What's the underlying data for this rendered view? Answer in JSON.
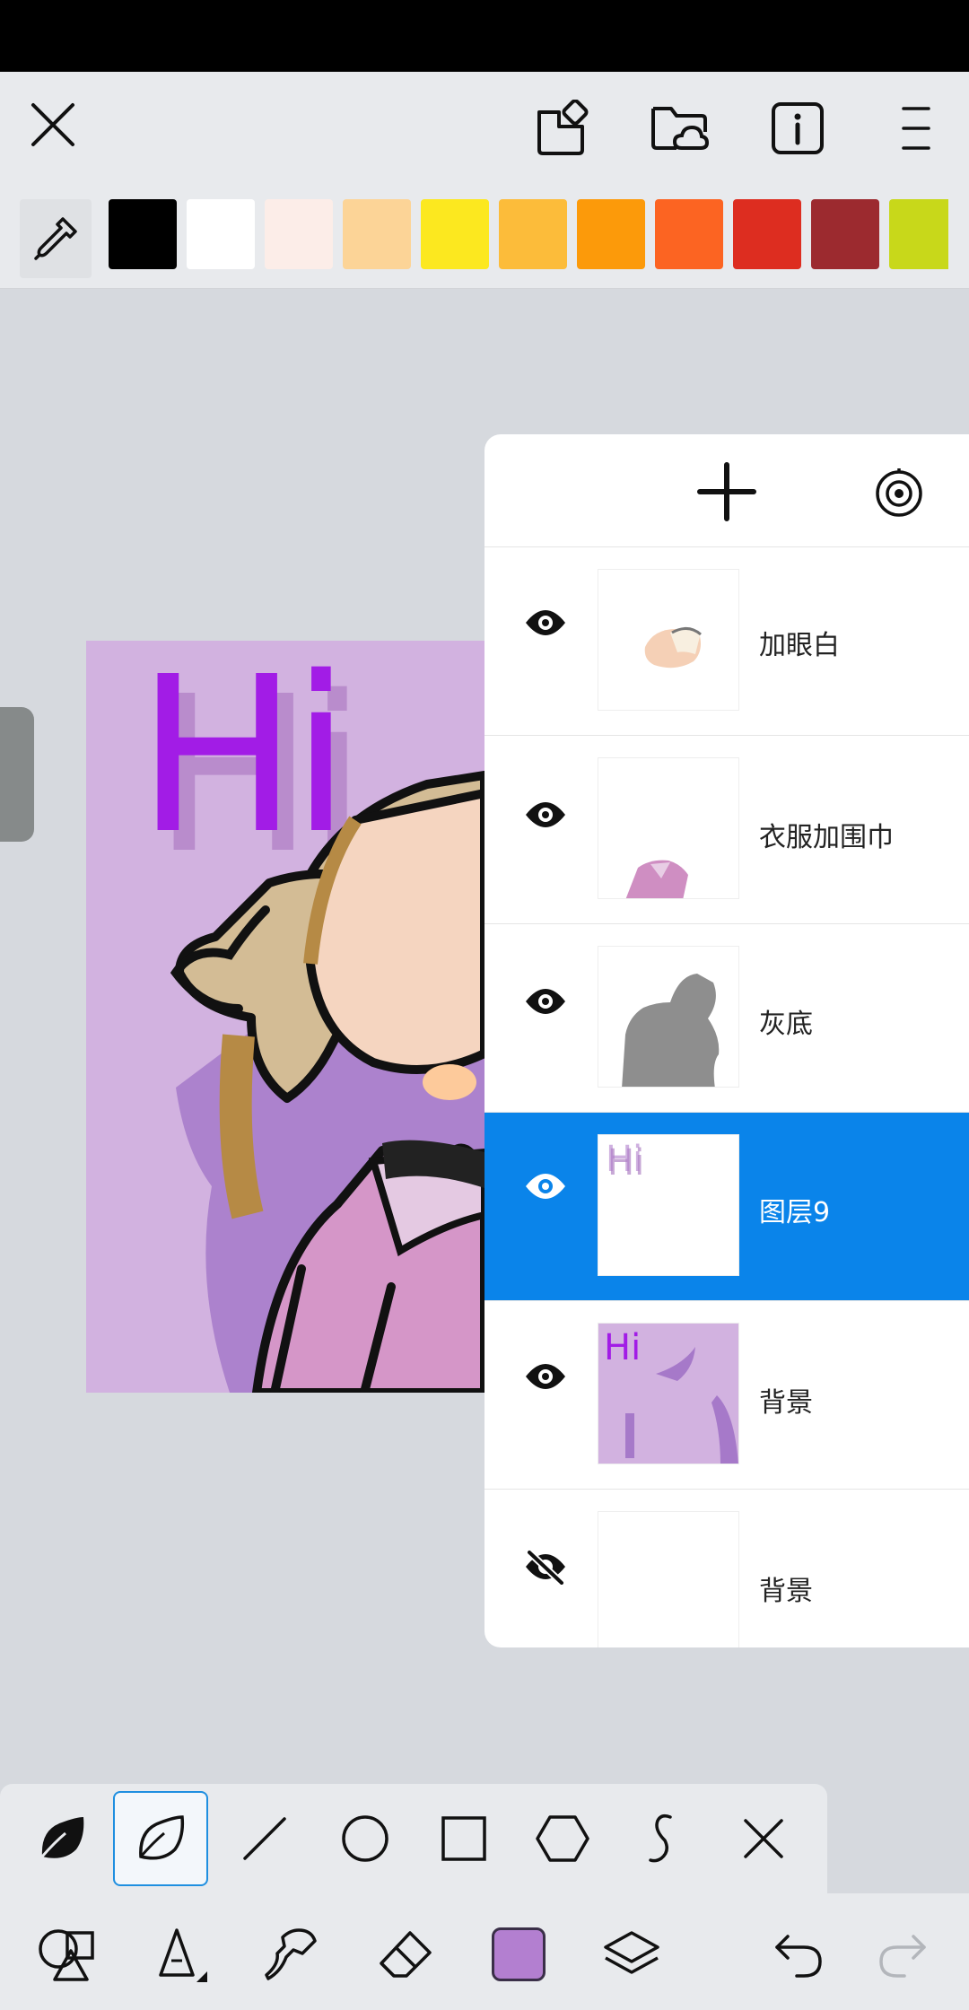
{
  "header": {
    "icons": [
      "close-icon",
      "share-icon",
      "folder-cloud-icon",
      "info-icon",
      "menu-icon"
    ]
  },
  "palette": {
    "tool_icon": "eyedropper-icon",
    "colors": [
      "#000000",
      "#ffffff",
      "#fcede8",
      "#fcd497",
      "#fce81f",
      "#fcbc3a",
      "#fc9a0a",
      "#fc6422",
      "#dd2d20",
      "#9c2a2f",
      "#c8d81a"
    ]
  },
  "canvas": {
    "background": "#d2b2e0",
    "text": "Hi",
    "text_color": "#a21ce6"
  },
  "layers": {
    "add_icon": "plus-icon",
    "settings_icon": "layer-settings-icon",
    "selected_color": "#0a84ea",
    "items": [
      {
        "name": "加眼白",
        "visible": true,
        "selected": false
      },
      {
        "name": "衣服加围巾",
        "visible": true,
        "selected": false
      },
      {
        "name": "灰底",
        "visible": true,
        "selected": false
      },
      {
        "name": "图层9",
        "visible": true,
        "selected": true
      },
      {
        "name": "背景",
        "visible": true,
        "selected": false
      },
      {
        "name": "背景",
        "visible": false,
        "selected": false
      }
    ]
  },
  "shape_tools": {
    "active": "freehand-outline",
    "items": [
      "freehand-fill-icon",
      "freehand-outline-icon",
      "line-icon",
      "circle-icon",
      "rectangle-icon",
      "hexagon-icon",
      "curve-icon",
      "close-icon"
    ]
  },
  "bottom_toolbar": {
    "current_color": "#b37fd0",
    "items": [
      "shapes-icon",
      "pen-icon",
      "smudge-icon",
      "eraser-icon",
      "color-icon",
      "layers-icon",
      "undo-icon",
      "redo-icon"
    ]
  }
}
